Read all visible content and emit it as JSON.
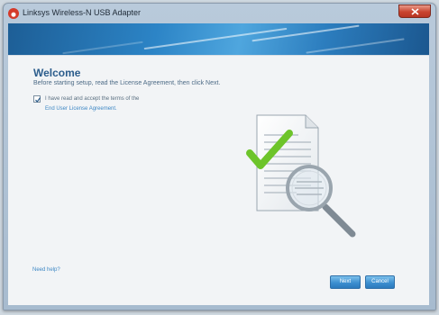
{
  "window": {
    "title": "Linksys Wireless-N USB Adapter"
  },
  "welcome": {
    "heading": "Welcome",
    "subtitle": "Before starting setup, read the License Agreement, then click Next.",
    "agree_label": "I have read and accept the terms of the",
    "agree_checked": true,
    "eula_link": "End User License Agreement."
  },
  "footer": {
    "help_link": "Need help?",
    "next_label": "Next",
    "cancel_label": "Cancel"
  },
  "colors": {
    "accent": "#2c84c6",
    "heading": "#2c5d8c",
    "check": "#6dc42a"
  },
  "icons": {
    "illustration": "document-search-check"
  }
}
